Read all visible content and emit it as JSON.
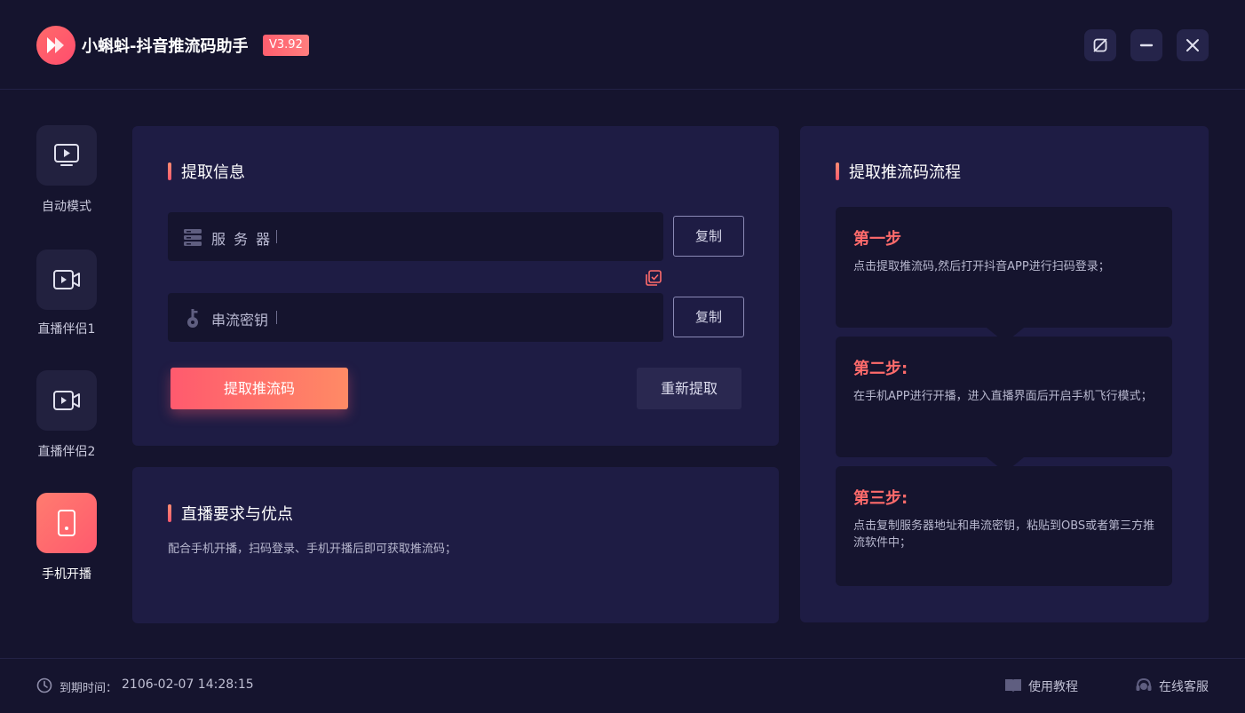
{
  "app": {
    "title": "小蝌蚪-抖音推流码助手",
    "version": "V3.92"
  },
  "window_controls": {
    "pin_icon": "no-pin-icon",
    "minimize_icon": "minimize-icon",
    "close_icon": "close-icon"
  },
  "sidebar": {
    "items": [
      {
        "label": "自动模式",
        "icon": "tv-play-icon",
        "active": false
      },
      {
        "label": "直播伴侣1",
        "icon": "video-camera-icon",
        "active": false
      },
      {
        "label": "直播伴侣2",
        "icon": "video-camera-icon",
        "active": false
      },
      {
        "label": "手机开播",
        "icon": "phone-icon",
        "active": true
      }
    ]
  },
  "extract": {
    "title": "提取信息",
    "server_label": "服 务 器",
    "server_value": "",
    "key_label": "串流密钥",
    "key_value": "",
    "copy_label": "复制",
    "extract_button": "提取推流码",
    "reextract_button": "重新提取"
  },
  "requirements": {
    "title": "直播要求与优点",
    "description": "配合手机开播，扫码登录、手机开播后即可获取推流码；"
  },
  "flow": {
    "title": "提取推流码流程",
    "steps": [
      {
        "title": "第一步",
        "desc": "点击提取推流码,然后打开抖音APP进行扫码登录；"
      },
      {
        "title": "第二步:",
        "desc": "在手机APP进行开播，进入直播界面后开启手机飞行模式；"
      },
      {
        "title": "第三步:",
        "desc": "点击复制服务器地址和串流密钥，粘贴到OBS或者第三方推流软件中；"
      }
    ]
  },
  "footer": {
    "expire_label": "到期时间：",
    "expire_value": "2106-02-07 14:28:15",
    "tutorial": "使用教程",
    "support": "在线客服"
  },
  "colors": {
    "accent": "#ff5a6e",
    "background": "#15142e",
    "panel": "#1e1c44"
  }
}
